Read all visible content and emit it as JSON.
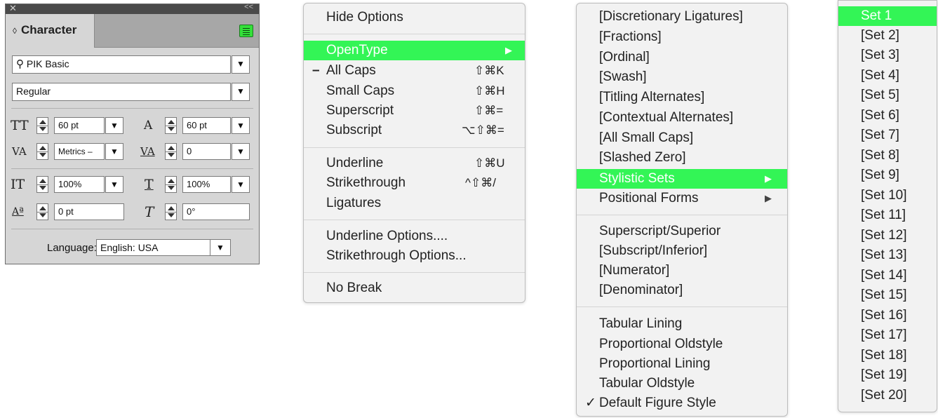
{
  "character_panel": {
    "close_glyph": "✕",
    "collapse_glyph": "<<",
    "tab_glyph": "◊",
    "tab_title": "Character",
    "search_glyph": "⚲",
    "font_family": "PIK Basic",
    "font_style": "Regular",
    "size_icon": "TT",
    "size": "60 pt",
    "leading_icon": "A",
    "leading": "60 pt",
    "kerning_icon": "VA",
    "kerning": "Metrics –",
    "tracking_icon": "VA",
    "tracking": "0",
    "vscale_icon": "IT",
    "vertical_scale": "100%",
    "hscale_icon": "T",
    "horizontal_scale": "100%",
    "baseline_icon": "Aª",
    "baseline_shift": "0 pt",
    "skew_icon": "T",
    "skew": "0°",
    "language_label": "Language:",
    "language": "English: USA",
    "dropdown_glyph": "▼",
    "accent_color": "#34e03a"
  },
  "menu1": {
    "items": [
      {
        "label": "Hide Options"
      },
      {
        "label": "OpenType",
        "submenu": "▶"
      },
      {
        "label": "All Caps",
        "mark": "–",
        "shortcut": "⇧⌘K"
      },
      {
        "label": "Small Caps",
        "shortcut": "⇧⌘H"
      },
      {
        "label": "Superscript",
        "shortcut": "⇧⌘="
      },
      {
        "label": "Subscript",
        "shortcut": "⌥⇧⌘="
      },
      {
        "label": "Underline",
        "shortcut": "⇧⌘U"
      },
      {
        "label": "Strikethrough",
        "shortcut": "^⇧⌘/"
      },
      {
        "label": "Ligatures"
      },
      {
        "label": "Underline Options...."
      },
      {
        "label": "Strikethrough Options..."
      },
      {
        "label": "No Break"
      }
    ]
  },
  "menu2": {
    "items": [
      {
        "label": "[Discretionary Ligatures]"
      },
      {
        "label": "[Fractions]"
      },
      {
        "label": "[Ordinal]"
      },
      {
        "label": "[Swash]"
      },
      {
        "label": "[Titling Alternates]"
      },
      {
        "label": "[Contextual Alternates]"
      },
      {
        "label": "[All Small Caps]"
      },
      {
        "label": "[Slashed Zero]"
      },
      {
        "label": "Stylistic Sets",
        "submenu": "▶"
      },
      {
        "label": "Positional Forms",
        "submenu": "▶"
      },
      {
        "label": "Superscript/Superior"
      },
      {
        "label": "[Subscript/Inferior]"
      },
      {
        "label": "[Numerator]"
      },
      {
        "label": "[Denominator]"
      },
      {
        "label": "Tabular Lining"
      },
      {
        "label": "Proportional Oldstyle"
      },
      {
        "label": "Proportional Lining"
      },
      {
        "label": "Tabular Oldstyle"
      },
      {
        "label": "Default Figure Style",
        "mark": "✓"
      }
    ]
  },
  "menu3": {
    "items": [
      {
        "label": "Set 1"
      },
      {
        "label": "[Set 2]"
      },
      {
        "label": "[Set 3]"
      },
      {
        "label": "[Set 4]"
      },
      {
        "label": "[Set 5]"
      },
      {
        "label": "[Set 6]"
      },
      {
        "label": "[Set 7]"
      },
      {
        "label": "[Set 8]"
      },
      {
        "label": "[Set 9]"
      },
      {
        "label": "[Set 10]"
      },
      {
        "label": "[Set 11]"
      },
      {
        "label": "[Set 12]"
      },
      {
        "label": "[Set 13]"
      },
      {
        "label": "[Set 14]"
      },
      {
        "label": "[Set 15]"
      },
      {
        "label": "[Set 16]"
      },
      {
        "label": "[Set 17]"
      },
      {
        "label": "[Set 18]"
      },
      {
        "label": "[Set 19]"
      },
      {
        "label": "[Set 20]"
      }
    ]
  },
  "highlight_color": "#33f556"
}
